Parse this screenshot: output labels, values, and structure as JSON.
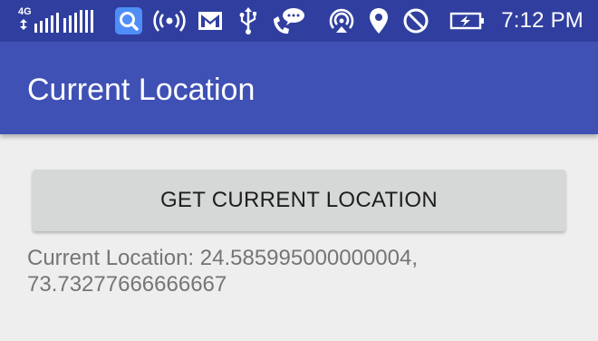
{
  "status_bar": {
    "network_label": "4G",
    "time": "7:12 PM",
    "icons": [
      "signal-icon",
      "search-app-icon",
      "hotspot-icon",
      "gmail-icon",
      "usb-icon",
      "missed-call-icon",
      "airplay-icon",
      "location-icon",
      "block-icon",
      "battery-charging-icon"
    ]
  },
  "app_bar": {
    "title": "Current Location"
  },
  "main": {
    "button_label": "GET CURRENT LOCATION",
    "location_text": "Current Location: 24.585995000000004, 73.73277666666667"
  },
  "colors": {
    "status_bar": "#303f9f",
    "app_bar": "#3f51b5",
    "background": "#eeeeee",
    "button": "#d6d7d7",
    "button_text": "#1e1e1e",
    "location_text": "#757575"
  }
}
